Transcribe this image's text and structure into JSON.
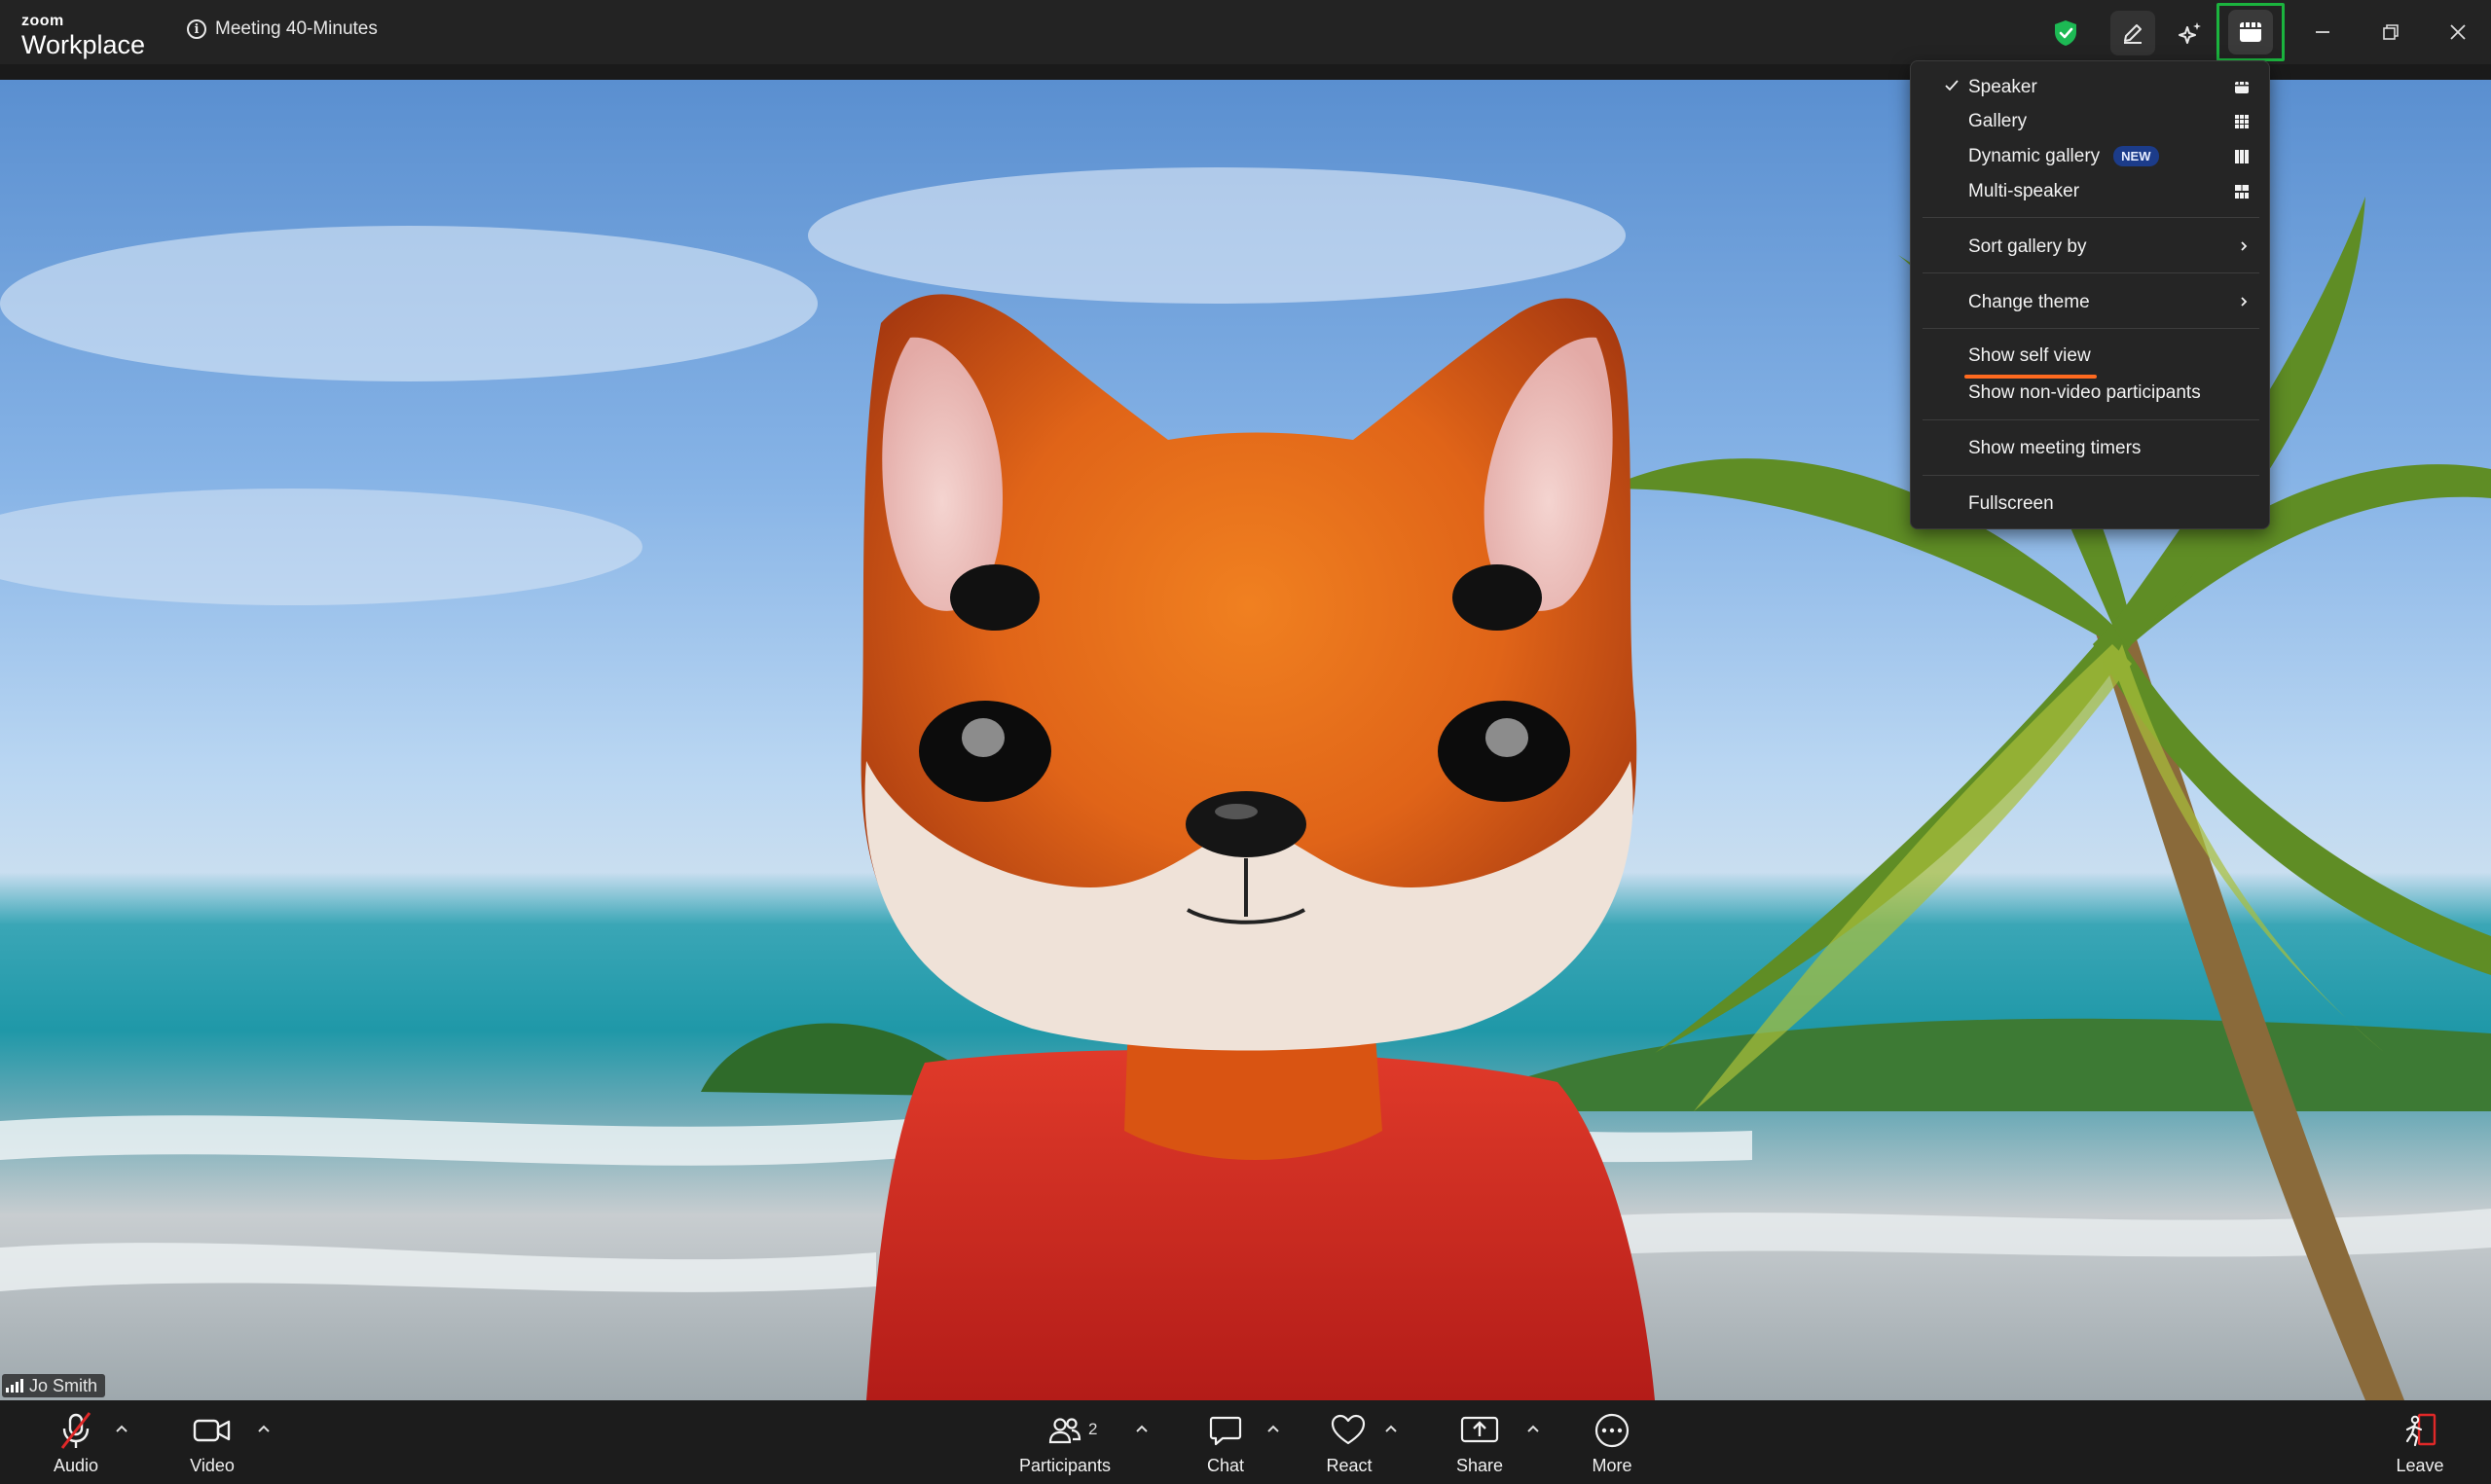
{
  "app": {
    "brand_small": "zoom",
    "brand_large": "Workplace"
  },
  "meeting": {
    "title": "Meeting 40-Minutes"
  },
  "participant": {
    "name": "Jo Smith"
  },
  "view_menu": {
    "layouts": [
      {
        "label": "Speaker",
        "checked": true,
        "icon": "speaker-layout-icon"
      },
      {
        "label": "Gallery",
        "checked": false,
        "icon": "gallery-grid-icon"
      },
      {
        "label": "Dynamic gallery",
        "checked": false,
        "badge": "NEW",
        "icon": "dynamic-gallery-icon"
      },
      {
        "label": "Multi-speaker",
        "checked": false,
        "icon": "multi-speaker-icon"
      }
    ],
    "sort_gallery": "Sort gallery by",
    "change_theme": "Change theme",
    "show_self_view": "Show self view",
    "show_non_video": "Show non-video participants",
    "show_timers": "Show meeting timers",
    "fullscreen": "Fullscreen"
  },
  "toolbar": {
    "audio": "Audio",
    "video": "Video",
    "participants": "Participants",
    "participants_count": "2",
    "chat": "Chat",
    "react": "React",
    "share": "Share",
    "more": "More",
    "leave": "Leave"
  },
  "colors": {
    "accent_green": "#1bb33e",
    "shield_green": "#1db954",
    "leave_red": "#e02828",
    "mute_red": "#e02828",
    "underline_orange": "#ff6a1f",
    "badge_blue": "#1c3c8a"
  }
}
